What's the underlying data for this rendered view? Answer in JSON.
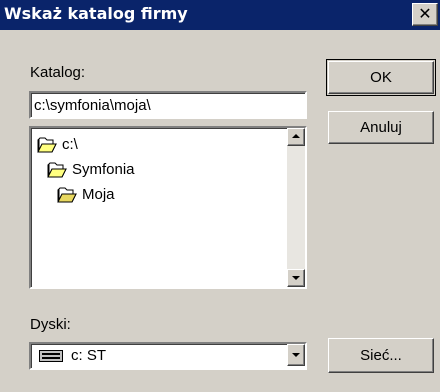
{
  "window": {
    "title": "Wskaż katalog firmy",
    "close_glyph": "✕"
  },
  "catalog": {
    "label": "Katalog:",
    "path_value": "c:\\symfonia\\moja\\"
  },
  "tree": {
    "items": [
      {
        "label": "c:\\",
        "icon": "open-folder-icon"
      },
      {
        "label": "Symfonia",
        "icon": "open-folder-icon"
      },
      {
        "label": "Moja",
        "icon": "open-folder-icon"
      }
    ]
  },
  "drives": {
    "label": "Dyski:",
    "selected": "c: ST",
    "icon": "hard-drive-icon"
  },
  "buttons": {
    "ok": "OK",
    "cancel": "Anuluj",
    "network": "Sieć..."
  },
  "colors": {
    "titlebar": "#0a246a",
    "face": "#d4d0c8",
    "folder": "#ffff00"
  }
}
